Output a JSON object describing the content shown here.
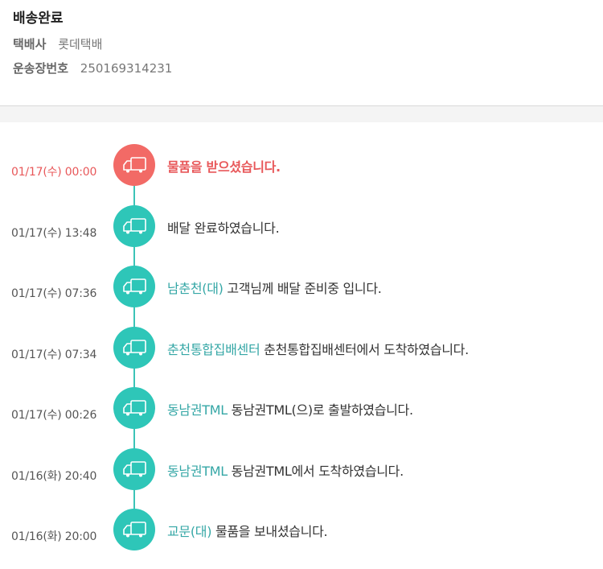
{
  "header": {
    "status": "배송완료",
    "courier_label": "택배사",
    "courier_value": "롯데택배",
    "tracking_label": "운송장번호",
    "tracking_value": "250169314231"
  },
  "colors": {
    "current": "#f26a66",
    "normal": "#2ec6b8",
    "location": "#35a7a6"
  },
  "events": [
    {
      "time": "01/17(수) 00:00",
      "location": "",
      "message": "물품을 받으셨습니다.",
      "icon": "truck-icon",
      "current": true
    },
    {
      "time": "01/17(수) 13:48",
      "location": "",
      "message": "배달 완료하였습니다.",
      "icon": "truck-icon",
      "current": false
    },
    {
      "time": "01/17(수) 07:36",
      "location": "남춘천(대)",
      "message": "고객님께 배달 준비중 입니다.",
      "icon": "truck-icon",
      "current": false
    },
    {
      "time": "01/17(수) 07:34",
      "location": "춘천통합집배센터",
      "message": "춘천통합집배센터에서 도착하였습니다.",
      "icon": "truck-icon",
      "current": false
    },
    {
      "time": "01/17(수) 00:26",
      "location": "동남권TML",
      "message": "동남권TML(으)로 출발하였습니다.",
      "icon": "truck-icon",
      "current": false
    },
    {
      "time": "01/16(화) 20:40",
      "location": "동남권TML",
      "message": "동남권TML에서 도착하였습니다.",
      "icon": "truck-icon",
      "current": false
    },
    {
      "time": "01/16(화) 20:00",
      "location": "교문(대)",
      "message": "물품을 보내셨습니다.",
      "icon": "truck-icon",
      "current": false
    }
  ]
}
